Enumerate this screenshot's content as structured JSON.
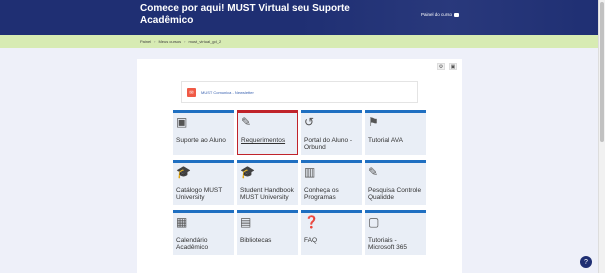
{
  "header": {
    "title": "Comece por aqui! MUST Virtual seu Suporte Acadêmico",
    "dashboard_link": "Painel do curso"
  },
  "breadcrumb": [
    "Painel",
    "Meus cursos",
    "must_virtual_gd_2"
  ],
  "news": {
    "label": "MUST Comunica - Newsletter"
  },
  "tiles": [
    {
      "label": "Suporte ao Aluno",
      "icon": "user-badge-icon"
    },
    {
      "label": "Requerimentos",
      "icon": "edit-icon"
    },
    {
      "label": "Portal do Aluno - Orbund",
      "icon": "history-icon"
    },
    {
      "label": "Tutorial AVA",
      "icon": "flag-icon"
    },
    {
      "label": "Catálogo MUST University",
      "icon": "graduation-cap-icon"
    },
    {
      "label": "Student Handbook MUST University",
      "icon": "graduation-cap-icon"
    },
    {
      "label": "Conheça os Programas",
      "icon": "building-icon"
    },
    {
      "label": "Pesquisa Controle Qualidde",
      "icon": "edit-icon"
    },
    {
      "label": "Calendário Acadêmico",
      "icon": "calendar-icon"
    },
    {
      "label": "Bibliotecas",
      "icon": "book-icon"
    },
    {
      "label": "FAQ",
      "icon": "question-icon"
    },
    {
      "label": "Tutoriais - Microsoft 365",
      "icon": "presentation-icon"
    }
  ],
  "colors": {
    "header_bg": "#1f2f73",
    "breadcrumb_bg": "#d7ebb3",
    "tile_accent": "#1f6fc1",
    "tile_active_accent": "#c0232b",
    "news_icon": "#f05a46"
  }
}
